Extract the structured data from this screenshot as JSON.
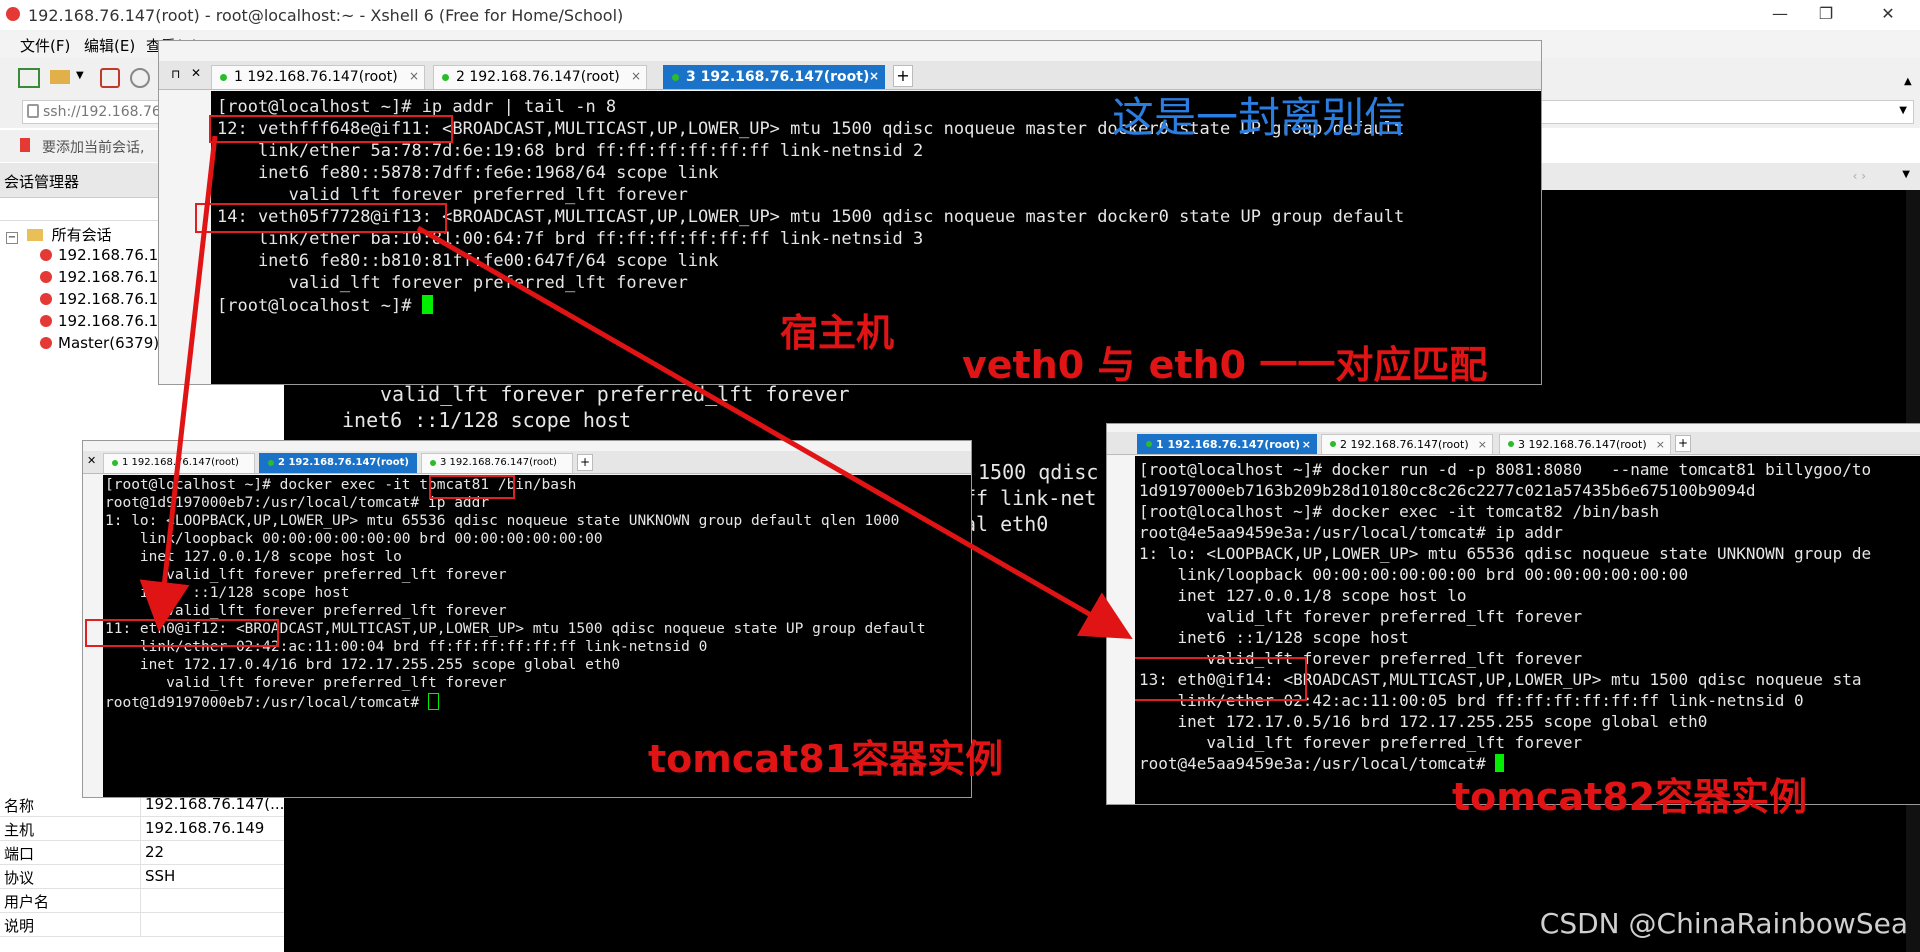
{
  "window": {
    "title": "192.168.76.147(root) - root@localhost:~ - Xshell 6 (Free for Home/School)",
    "controls": [
      "—",
      "❐",
      "✕"
    ]
  },
  "menu": [
    "文件(F)",
    "编辑(E)",
    "查看(V)"
  ],
  "address": {
    "url": "ssh://192.168.76"
  },
  "hint": {
    "text": "要添加当前会话,"
  },
  "session_manager": {
    "title": "会话管理器",
    "root": "所有会话",
    "items": [
      "192.168.76.1",
      "192.168.76.1",
      "192.168.76.1",
      "192.168.76.1",
      "Master(6379)"
    ]
  },
  "properties": [
    {
      "key": "名称",
      "value": "192.168.76.147(..."
    },
    {
      "key": "主机",
      "value": "192.168.76.149"
    },
    {
      "key": "端口",
      "value": "22"
    },
    {
      "key": "协议",
      "value": "SSH"
    },
    {
      "key": "用户名",
      "value": ""
    },
    {
      "key": "说明",
      "value": ""
    }
  ],
  "background_terminal": {
    "lines": [
      "valid_lft forever preferred_lft forever",
      "inet6 ::1/128 scope host",
      "1500 qdisc",
      "ff link-net",
      "al eth0"
    ]
  },
  "host_terminal": {
    "tabs": [
      {
        "label": "1 192.168.76.147(root)",
        "active": false
      },
      {
        "label": "2 192.168.76.147(root)",
        "active": false
      },
      {
        "label": "3 192.168.76.147(root)",
        "active": true
      }
    ],
    "lines": [
      "[root@localhost ~]# ip addr | tail -n 8",
      "12: vethfff648e@if11: <BROADCAST,MULTICAST,UP,LOWER_UP> mtu 1500 qdisc noqueue master docker0 state UP group default",
      "    link/ether 5a:78:7d:6e:19:68 brd ff:ff:ff:ff:ff:ff link-netnsid 2",
      "    inet6 fe80::5878:7dff:fe6e:1968/64 scope link",
      "       valid_lft forever preferred_lft forever",
      "14: veth05f7728@if13: <BROADCAST,MULTICAST,UP,LOWER_UP> mtu 1500 qdisc noqueue master docker0 state UP group default",
      "    link/ether ba:10:81:00:64:7f brd ff:ff:ff:ff:ff:ff link-netnsid 3",
      "    inet6 fe80::b810:81ff:fe00:647f/64 scope link",
      "       valid_lft forever preferred_lft forever",
      "[root@localhost ~]# "
    ]
  },
  "tomcat81_terminal": {
    "tabs": [
      {
        "label": "1 192.168.76.147(root)",
        "active": false
      },
      {
        "label": "2 192.168.76.147(root)",
        "active": true
      },
      {
        "label": "3 192.168.76.147(root)",
        "active": false
      }
    ],
    "lines": [
      "[root@localhost ~]# docker exec -it tomcat81 /bin/bash",
      "root@1d9197000eb7:/usr/local/tomcat# ip addr",
      "1: lo: <LOOPBACK,UP,LOWER_UP> mtu 65536 qdisc noqueue state UNKNOWN group default qlen 1000",
      "    link/loopback 00:00:00:00:00:00 brd 00:00:00:00:00:00",
      "    inet 127.0.0.1/8 scope host lo",
      "       valid_lft forever preferred_lft forever",
      "    inet6 ::1/128 scope host",
      "       valid_lft forever preferred_lft forever",
      "11: eth0@if12: <BROADCAST,MULTICAST,UP,LOWER_UP> mtu 1500 qdisc noqueue state UP group default",
      "    link/ether 02:42:ac:11:00:04 brd ff:ff:ff:ff:ff:ff link-netnsid 0",
      "    inet 172.17.0.4/16 brd 172.17.255.255 scope global eth0",
      "       valid_lft forever preferred_lft forever",
      "root@1d9197000eb7:/usr/local/tomcat# "
    ]
  },
  "tomcat82_terminal": {
    "tabs": [
      {
        "label": "1 192.168.76.147(root)",
        "active": true
      },
      {
        "label": "2 192.168.76.147(root)",
        "active": false
      },
      {
        "label": "3 192.168.76.147(root)",
        "active": false
      }
    ],
    "lines": [
      "[root@localhost ~]# docker run -d -p 8081:8080   --name tomcat81 billygoo/to",
      "1d9197000eb7163b209b28d10180cc8c26c2277c021a57435b6e675100b9094d",
      "[root@localhost ~]# docker exec -it tomcat82 /bin/bash",
      "root@4e5aa9459e3a:/usr/local/tomcat# ip addr",
      "1: lo: <LOOPBACK,UP,LOWER_UP> mtu 65536 qdisc noqueue state UNKNOWN group de",
      "    link/loopback 00:00:00:00:00:00 brd 00:00:00:00:00:00",
      "    inet 127.0.0.1/8 scope host lo",
      "       valid_lft forever preferred_lft forever",
      "    inet6 ::1/128 scope host",
      "       valid_lft forever preferred_lft forever",
      "13: eth0@if14: <BROADCAST,MULTICAST,UP,LOWER_UP> mtu 1500 qdisc noqueue sta",
      "    link/ether 02:42:ac:11:00:05 brd ff:ff:ff:ff:ff:ff link-netnsid 0",
      "    inet 172.17.0.5/16 brd 172.17.255.255 scope global eth0",
      "       valid_lft forever preferred_lft forever",
      "root@4e5aa9459e3a:/usr/local/tomcat# "
    ]
  },
  "annotations": {
    "title": "这是一封离别信",
    "host": "宿主机",
    "match": "veth0   与 eth0  一一对应匹配",
    "tomcat81": "tomcat81容器实例",
    "tomcat82": "tomcat82容器实例"
  },
  "watermark": "CSDN @ChinaRainbowSea",
  "colors": {
    "annotation": "#e01414",
    "active_tab": "#1a73c9",
    "cursor": "#00ee00",
    "title_annotation": "#2a7de1"
  }
}
